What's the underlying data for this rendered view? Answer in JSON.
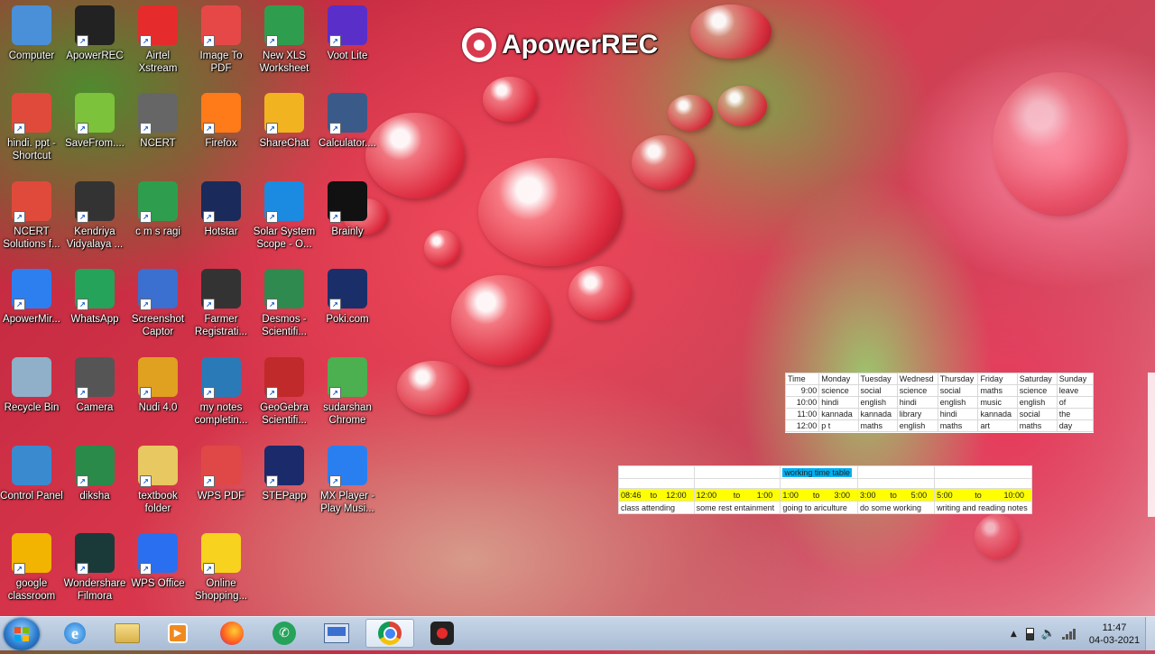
{
  "watermark": {
    "text": "ApowerREC"
  },
  "desktop_icons": [
    {
      "label": "Computer",
      "icon": "computer-icon",
      "color": "#4a90d9"
    },
    {
      "label": "ApowerREC",
      "icon": "apowerrec-icon",
      "color": "#222222"
    },
    {
      "label": "Airtel Xstream",
      "icon": "airtel-icon",
      "color": "#e52b2b"
    },
    {
      "label": "Image To PDF",
      "icon": "image-to-pdf-icon",
      "color": "#e64848"
    },
    {
      "label": "New XLS Worksheet",
      "icon": "xls-worksheet-icon",
      "color": "#2e9e4e"
    },
    {
      "label": "Voot Lite",
      "icon": "voot-icon",
      "color": "#5a2fc9"
    },
    {
      "label": "hindi. ppt - Shortcut",
      "icon": "ppt-file-icon",
      "color": "#e04a3a"
    },
    {
      "label": "SaveFrom....",
      "icon": "download-arrow-icon",
      "color": "#7cc23a"
    },
    {
      "label": "NCERT",
      "icon": "ncert-icon",
      "color": "#666666"
    },
    {
      "label": "Firefox",
      "icon": "firefox-icon",
      "color": "#ff7a18"
    },
    {
      "label": "ShareChat",
      "icon": "sharechat-icon",
      "color": "#f2b320"
    },
    {
      "label": "Calculator....",
      "icon": "calculator-icon",
      "color": "#3a5a8a"
    },
    {
      "label": "NCERT Solutions f...",
      "icon": "ppt-file-icon",
      "color": "#e04a3a"
    },
    {
      "label": "Kendriya Vidyalaya ...",
      "icon": "kendriya-icon",
      "color": "#333333"
    },
    {
      "label": "c m s ragi",
      "icon": "sheet-file-icon",
      "color": "#2e9e4e"
    },
    {
      "label": "Hotstar",
      "icon": "hotstar-icon",
      "color": "#1a2a5a"
    },
    {
      "label": "Solar System Scope - O...",
      "icon": "solar-system-icon",
      "color": "#1a8be0"
    },
    {
      "label": "Brainly",
      "icon": "brainly-icon",
      "color": "#111111"
    },
    {
      "label": "ApowerMir...",
      "icon": "apowermirror-icon",
      "color": "#2d7ff0"
    },
    {
      "label": "WhatsApp",
      "icon": "whatsapp-icon",
      "color": "#25a35a"
    },
    {
      "label": "Screenshot Captor",
      "icon": "screenshot-captor-icon",
      "color": "#3b6fd0"
    },
    {
      "label": "Farmer Registrati...",
      "icon": "farmer-icon",
      "color": "#333333"
    },
    {
      "label": "Desmos - Scientifi...",
      "icon": "desmos-icon",
      "color": "#2e8a4e"
    },
    {
      "label": "Poki.com",
      "icon": "poki-icon",
      "color": "#1a2f6a"
    },
    {
      "label": "Recycle Bin",
      "icon": "recycle-bin-icon",
      "color": "#8fb0c8"
    },
    {
      "label": "Camera",
      "icon": "camera-icon",
      "color": "#555555"
    },
    {
      "label": "Nudi 4.0",
      "icon": "nudi-icon",
      "color": "#e0a020"
    },
    {
      "label": "my notes completin...",
      "icon": "notes-icon",
      "color": "#2a7ab8"
    },
    {
      "label": "GeoGebra Scientifi...",
      "icon": "geogebra-icon",
      "color": "#c02a2a"
    },
    {
      "label": "sudarshan Chrome",
      "icon": "chrome-icon",
      "color": "#4caf50"
    },
    {
      "label": "Control Panel",
      "icon": "control-panel-icon",
      "color": "#3a8ad0"
    },
    {
      "label": "diksha",
      "icon": "diksha-icon",
      "color": "#2a8a4a"
    },
    {
      "label": "textbook folder",
      "icon": "folder-icon",
      "color": "#e8c860"
    },
    {
      "label": "WPS PDF",
      "icon": "wps-pdf-icon",
      "color": "#e04848"
    },
    {
      "label": "STEPapp",
      "icon": "stepapp-icon",
      "color": "#1a2a6a"
    },
    {
      "label": "MX Player - Play Musi...",
      "icon": "mx-player-icon",
      "color": "#2a7ff0"
    },
    {
      "label": "google classroom",
      "icon": "google-classroom-icon",
      "color": "#f2b400"
    },
    {
      "label": "Wondershare Filmora",
      "icon": "filmora-icon",
      "color": "#1a3a3a"
    },
    {
      "label": "WPS Office",
      "icon": "wps-office-icon",
      "color": "#2a6ff0"
    },
    {
      "label": "Online Shopping...",
      "icon": "flipkart-icon",
      "color": "#f7d21e"
    }
  ],
  "timetable": {
    "headers": [
      "Time",
      "Monday",
      "Tuesday",
      "Wednesd",
      "Thursday",
      "Friday",
      "Saturday",
      "Sunday"
    ],
    "rows": [
      [
        "9:00",
        "science",
        "social",
        "science",
        "social",
        "maths",
        "science",
        "leave"
      ],
      [
        "10:00",
        "hindi",
        "english",
        "hindi",
        "english",
        "music",
        "english",
        "of"
      ],
      [
        "11:00",
        "kannada",
        "kannada",
        "library",
        "hindi",
        "kannada",
        "social",
        "the"
      ],
      [
        "12:00",
        "p  t",
        "maths",
        "english",
        "maths",
        "art",
        "maths",
        "day"
      ]
    ]
  },
  "working_table": {
    "title": "working time table",
    "times": [
      [
        "08:46",
        "to",
        "12:00"
      ],
      [
        "12:00",
        "to",
        "1:00"
      ],
      [
        "1:00",
        "to",
        "3:00"
      ],
      [
        "3:00",
        "to",
        "5:00"
      ],
      [
        "5:00",
        "to",
        "10:00"
      ]
    ],
    "activities": [
      "class attending",
      "some rest entainment",
      "going to ariculture",
      "do some working",
      "writing and reading notes"
    ]
  },
  "taskbar": {
    "items": [
      {
        "name": "taskbar-ie-icon",
        "icon": "internet-explorer-icon"
      },
      {
        "name": "taskbar-explorer-icon",
        "icon": "file-explorer-icon"
      },
      {
        "name": "taskbar-media-player-icon",
        "icon": "media-player-icon"
      },
      {
        "name": "taskbar-firefox-icon",
        "icon": "firefox-icon"
      },
      {
        "name": "taskbar-whatsapp-icon",
        "icon": "whatsapp-icon"
      },
      {
        "name": "taskbar-screenshot-icon",
        "icon": "screenshot-captor-icon"
      },
      {
        "name": "taskbar-chrome-icon",
        "icon": "chrome-icon"
      },
      {
        "name": "taskbar-apowerrec-icon",
        "icon": "apowerrec-icon"
      }
    ],
    "clock": {
      "time": "11:47",
      "date": "04-03-2021"
    },
    "accent_colors": {
      "bar": "#b3c4da",
      "highlight_yellow": "#ffff00",
      "title_cyan": "#00b0f0"
    }
  }
}
